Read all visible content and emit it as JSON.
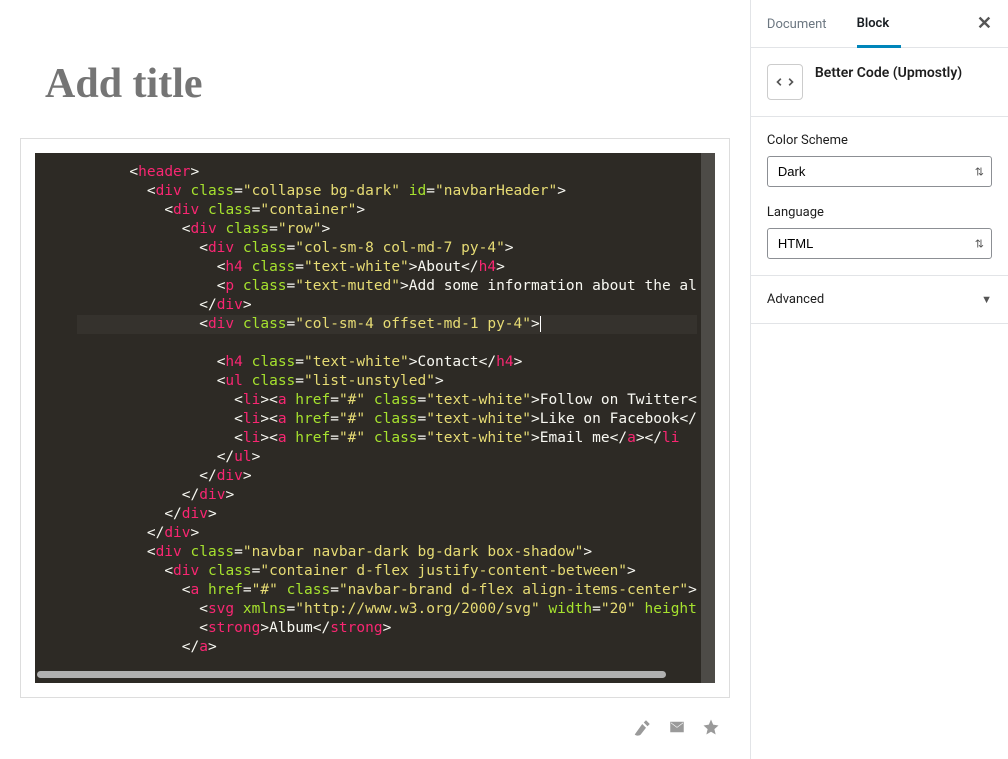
{
  "editor": {
    "title_placeholder": "Add title"
  },
  "code": {
    "lines": [
      [
        {
          "cls": "br",
          "t": "<"
        },
        {
          "cls": "tag",
          "t": "header"
        },
        {
          "cls": "br",
          "t": ">"
        }
      ],
      [
        {
          "cls": "br",
          "t": "<"
        },
        {
          "cls": "tag",
          "t": "div"
        },
        {
          "cls": "txt",
          "t": " "
        },
        {
          "cls": "attr",
          "t": "class"
        },
        {
          "cls": "op",
          "t": "="
        },
        {
          "cls": "str",
          "t": "\"collapse bg-dark\""
        },
        {
          "cls": "txt",
          "t": " "
        },
        {
          "cls": "attr",
          "t": "id"
        },
        {
          "cls": "op",
          "t": "="
        },
        {
          "cls": "str",
          "t": "\"navbarHeader\""
        },
        {
          "cls": "br",
          "t": ">"
        }
      ],
      [
        {
          "cls": "br",
          "t": "<"
        },
        {
          "cls": "tag",
          "t": "div"
        },
        {
          "cls": "txt",
          "t": " "
        },
        {
          "cls": "attr",
          "t": "class"
        },
        {
          "cls": "op",
          "t": "="
        },
        {
          "cls": "str",
          "t": "\"container\""
        },
        {
          "cls": "br",
          "t": ">"
        }
      ],
      [
        {
          "cls": "br",
          "t": "<"
        },
        {
          "cls": "tag",
          "t": "div"
        },
        {
          "cls": "txt",
          "t": " "
        },
        {
          "cls": "attr",
          "t": "class"
        },
        {
          "cls": "op",
          "t": "="
        },
        {
          "cls": "str",
          "t": "\"row\""
        },
        {
          "cls": "br",
          "t": ">"
        }
      ],
      [
        {
          "cls": "br",
          "t": "<"
        },
        {
          "cls": "tag",
          "t": "div"
        },
        {
          "cls": "txt",
          "t": " "
        },
        {
          "cls": "attr",
          "t": "class"
        },
        {
          "cls": "op",
          "t": "="
        },
        {
          "cls": "str",
          "t": "\"col-sm-8 col-md-7 py-4\""
        },
        {
          "cls": "br",
          "t": ">"
        }
      ],
      [
        {
          "cls": "br",
          "t": "<"
        },
        {
          "cls": "tag",
          "t": "h4"
        },
        {
          "cls": "txt",
          "t": " "
        },
        {
          "cls": "attr",
          "t": "class"
        },
        {
          "cls": "op",
          "t": "="
        },
        {
          "cls": "str",
          "t": "\"text-white\""
        },
        {
          "cls": "br",
          "t": ">"
        },
        {
          "cls": "txt",
          "t": "About"
        },
        {
          "cls": "br",
          "t": "</"
        },
        {
          "cls": "tag",
          "t": "h4"
        },
        {
          "cls": "br",
          "t": ">"
        }
      ],
      [
        {
          "cls": "br",
          "t": "<"
        },
        {
          "cls": "tag",
          "t": "p"
        },
        {
          "cls": "txt",
          "t": " "
        },
        {
          "cls": "attr",
          "t": "class"
        },
        {
          "cls": "op",
          "t": "="
        },
        {
          "cls": "str",
          "t": "\"text-muted\""
        },
        {
          "cls": "br",
          "t": ">"
        },
        {
          "cls": "txt",
          "t": "Add some information about the al"
        }
      ],
      [
        {
          "cls": "br",
          "t": "</"
        },
        {
          "cls": "tag",
          "t": "div"
        },
        {
          "cls": "br",
          "t": ">"
        }
      ],
      [
        {
          "cls": "br",
          "t": "<"
        },
        {
          "cls": "tag",
          "t": "div"
        },
        {
          "cls": "txt",
          "t": " "
        },
        {
          "cls": "attr",
          "t": "class"
        },
        {
          "cls": "op",
          "t": "="
        },
        {
          "cls": "str",
          "t": "\"col-sm-4 offset-md-1 py-4\""
        },
        {
          "cls": "br",
          "t": ">"
        }
      ],
      [
        {
          "cls": "br",
          "t": "<"
        },
        {
          "cls": "tag",
          "t": "h4"
        },
        {
          "cls": "txt",
          "t": " "
        },
        {
          "cls": "attr",
          "t": "class"
        },
        {
          "cls": "op",
          "t": "="
        },
        {
          "cls": "str",
          "t": "\"text-white\""
        },
        {
          "cls": "br",
          "t": ">"
        },
        {
          "cls": "txt",
          "t": "Contact"
        },
        {
          "cls": "br",
          "t": "</"
        },
        {
          "cls": "tag",
          "t": "h4"
        },
        {
          "cls": "br",
          "t": ">"
        }
      ],
      [
        {
          "cls": "br",
          "t": "<"
        },
        {
          "cls": "tag",
          "t": "ul"
        },
        {
          "cls": "txt",
          "t": " "
        },
        {
          "cls": "attr",
          "t": "class"
        },
        {
          "cls": "op",
          "t": "="
        },
        {
          "cls": "str",
          "t": "\"list-unstyled\""
        },
        {
          "cls": "br",
          "t": ">"
        }
      ],
      [
        {
          "cls": "br",
          "t": "<"
        },
        {
          "cls": "tag",
          "t": "li"
        },
        {
          "cls": "br",
          "t": ">"
        },
        {
          "cls": "br",
          "t": "<"
        },
        {
          "cls": "tag",
          "t": "a"
        },
        {
          "cls": "txt",
          "t": " "
        },
        {
          "cls": "attr",
          "t": "href"
        },
        {
          "cls": "op",
          "t": "="
        },
        {
          "cls": "str",
          "t": "\"#\""
        },
        {
          "cls": "txt",
          "t": " "
        },
        {
          "cls": "attr",
          "t": "class"
        },
        {
          "cls": "op",
          "t": "="
        },
        {
          "cls": "str",
          "t": "\"text-white\""
        },
        {
          "cls": "br",
          "t": ">"
        },
        {
          "cls": "txt",
          "t": "Follow on Twitter<"
        }
      ],
      [
        {
          "cls": "br",
          "t": "<"
        },
        {
          "cls": "tag",
          "t": "li"
        },
        {
          "cls": "br",
          "t": ">"
        },
        {
          "cls": "br",
          "t": "<"
        },
        {
          "cls": "tag",
          "t": "a"
        },
        {
          "cls": "txt",
          "t": " "
        },
        {
          "cls": "attr",
          "t": "href"
        },
        {
          "cls": "op",
          "t": "="
        },
        {
          "cls": "str",
          "t": "\"#\""
        },
        {
          "cls": "txt",
          "t": " "
        },
        {
          "cls": "attr",
          "t": "class"
        },
        {
          "cls": "op",
          "t": "="
        },
        {
          "cls": "str",
          "t": "\"text-white\""
        },
        {
          "cls": "br",
          "t": ">"
        },
        {
          "cls": "txt",
          "t": "Like on Facebook</"
        }
      ],
      [
        {
          "cls": "br",
          "t": "<"
        },
        {
          "cls": "tag",
          "t": "li"
        },
        {
          "cls": "br",
          "t": ">"
        },
        {
          "cls": "br",
          "t": "<"
        },
        {
          "cls": "tag",
          "t": "a"
        },
        {
          "cls": "txt",
          "t": " "
        },
        {
          "cls": "attr",
          "t": "href"
        },
        {
          "cls": "op",
          "t": "="
        },
        {
          "cls": "str",
          "t": "\"#\""
        },
        {
          "cls": "txt",
          "t": " "
        },
        {
          "cls": "attr",
          "t": "class"
        },
        {
          "cls": "op",
          "t": "="
        },
        {
          "cls": "str",
          "t": "\"text-white\""
        },
        {
          "cls": "br",
          "t": ">"
        },
        {
          "cls": "txt",
          "t": "Email me"
        },
        {
          "cls": "br",
          "t": "</"
        },
        {
          "cls": "tag",
          "t": "a"
        },
        {
          "cls": "br",
          "t": ">"
        },
        {
          "cls": "br",
          "t": "</"
        },
        {
          "cls": "tag",
          "t": "li"
        }
      ],
      [
        {
          "cls": "br",
          "t": "</"
        },
        {
          "cls": "tag",
          "t": "ul"
        },
        {
          "cls": "br",
          "t": ">"
        }
      ],
      [
        {
          "cls": "br",
          "t": "</"
        },
        {
          "cls": "tag",
          "t": "div"
        },
        {
          "cls": "br",
          "t": ">"
        }
      ],
      [
        {
          "cls": "br",
          "t": "</"
        },
        {
          "cls": "tag",
          "t": "div"
        },
        {
          "cls": "br",
          "t": ">"
        }
      ],
      [
        {
          "cls": "br",
          "t": "</"
        },
        {
          "cls": "tag",
          "t": "div"
        },
        {
          "cls": "br",
          "t": ">"
        }
      ],
      [
        {
          "cls": "br",
          "t": "</"
        },
        {
          "cls": "tag",
          "t": "div"
        },
        {
          "cls": "br",
          "t": ">"
        }
      ],
      [
        {
          "cls": "br",
          "t": "<"
        },
        {
          "cls": "tag",
          "t": "div"
        },
        {
          "cls": "txt",
          "t": " "
        },
        {
          "cls": "attr",
          "t": "class"
        },
        {
          "cls": "op",
          "t": "="
        },
        {
          "cls": "str",
          "t": "\"navbar navbar-dark bg-dark box-shadow\""
        },
        {
          "cls": "br",
          "t": ">"
        }
      ],
      [
        {
          "cls": "br",
          "t": "<"
        },
        {
          "cls": "tag",
          "t": "div"
        },
        {
          "cls": "txt",
          "t": " "
        },
        {
          "cls": "attr",
          "t": "class"
        },
        {
          "cls": "op",
          "t": "="
        },
        {
          "cls": "str",
          "t": "\"container d-flex justify-content-between\""
        },
        {
          "cls": "br",
          "t": ">"
        }
      ],
      [
        {
          "cls": "br",
          "t": "<"
        },
        {
          "cls": "tag",
          "t": "a"
        },
        {
          "cls": "txt",
          "t": " "
        },
        {
          "cls": "attr",
          "t": "href"
        },
        {
          "cls": "op",
          "t": "="
        },
        {
          "cls": "str",
          "t": "\"#\""
        },
        {
          "cls": "txt",
          "t": " "
        },
        {
          "cls": "attr",
          "t": "class"
        },
        {
          "cls": "op",
          "t": "="
        },
        {
          "cls": "str",
          "t": "\"navbar-brand d-flex align-items-center\""
        },
        {
          "cls": "br",
          "t": ">"
        }
      ],
      [
        {
          "cls": "br",
          "t": "<"
        },
        {
          "cls": "tag",
          "t": "svg"
        },
        {
          "cls": "txt",
          "t": " "
        },
        {
          "cls": "attr",
          "t": "xmlns"
        },
        {
          "cls": "op",
          "t": "="
        },
        {
          "cls": "str",
          "t": "\"http://www.w3.org/2000/svg\""
        },
        {
          "cls": "txt",
          "t": " "
        },
        {
          "cls": "attr",
          "t": "width"
        },
        {
          "cls": "op",
          "t": "="
        },
        {
          "cls": "str",
          "t": "\"20\""
        },
        {
          "cls": "txt",
          "t": " "
        },
        {
          "cls": "attr",
          "t": "height"
        }
      ],
      [
        {
          "cls": "br",
          "t": "<"
        },
        {
          "cls": "tag",
          "t": "strong"
        },
        {
          "cls": "br",
          "t": ">"
        },
        {
          "cls": "txt",
          "t": "Album"
        },
        {
          "cls": "br",
          "t": "</"
        },
        {
          "cls": "tag",
          "t": "strong"
        },
        {
          "cls": "br",
          "t": ">"
        }
      ],
      [
        {
          "cls": "br",
          "t": "</"
        },
        {
          "cls": "tag",
          "t": "a"
        },
        {
          "cls": "br",
          "t": ">"
        }
      ]
    ],
    "indents": [
      3,
      4,
      5,
      6,
      7,
      8,
      8,
      7,
      7,
      8,
      8,
      9,
      9,
      9,
      8,
      7,
      6,
      5,
      4,
      4,
      5,
      6,
      7,
      7,
      6
    ],
    "highlighted_line": 8,
    "cursor_line": 8
  },
  "sidebar": {
    "tabs": {
      "document": "Document",
      "block": "Block"
    },
    "close": "✕",
    "block_name": "Better Code (Upmostly)",
    "color_scheme": {
      "label": "Color Scheme",
      "value": "Dark"
    },
    "language": {
      "label": "Language",
      "value": "HTML"
    },
    "advanced": "Advanced"
  }
}
